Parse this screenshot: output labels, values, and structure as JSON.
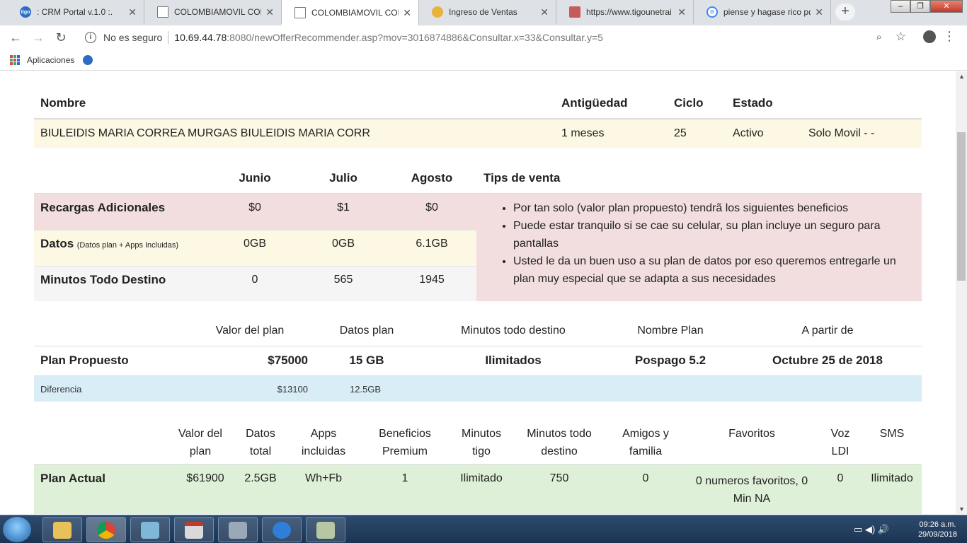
{
  "browser": {
    "tabs": [
      {
        "title": ": CRM Portal v.1.0 :."
      },
      {
        "title": "COLOMBIAMOVIL CONS"
      },
      {
        "title": "COLOMBIAMOVIL CONS"
      },
      {
        "title": "Ingreso de Ventas"
      },
      {
        "title": "https://www.tigounetrai"
      },
      {
        "title": "piense y hagase rico pdf"
      }
    ],
    "security": "No es seguro",
    "url_host": "10.69.44.78",
    "url_rest": ":8080/newOfferRecommender.asp?mov=3016874886&Consultar.x=33&Consultar.y=5",
    "bookmarks_label": "Aplicaciones"
  },
  "customer": {
    "headers": {
      "nombre": "Nombre",
      "antiguedad": "Antigüedad",
      "ciclo": "Ciclo",
      "estado": "Estado"
    },
    "nombre": "BIULEIDIS MARIA CORREA MURGAS BIULEIDIS MARIA CORR",
    "antiguedad": "1 meses",
    "ciclo": "25",
    "estado": "Activo",
    "tipo": "Solo Movil - -"
  },
  "consumo": {
    "months": [
      "Junio",
      "Julio",
      "Agosto"
    ],
    "tips_header": "Tips de venta",
    "rows": [
      {
        "label": "Recargas Adicionales",
        "sub": "",
        "values": [
          "$0",
          "$1",
          "$0"
        ]
      },
      {
        "label": "Datos",
        "sub": "(Datos plan + Apps Incluidas)",
        "values": [
          "0GB",
          "0GB",
          "6.1GB"
        ]
      },
      {
        "label": "Minutos Todo Destino",
        "sub": "",
        "values": [
          "0",
          "565",
          "1945"
        ]
      }
    ],
    "tips": [
      "Por tan solo (valor plan propuesto) tendrã los siguientes beneficios",
      "Puede estar tranquilo si se cae su celular, su plan incluye un seguro para pantallas",
      "Usted le da un buen uso a su plan de datos por eso queremos entregarle un plan muy especial que se adapta a sus necesidades"
    ]
  },
  "propuesto": {
    "headers": [
      "Valor del plan",
      "Datos plan",
      "Minutos todo destino",
      "Nombre Plan",
      "A partir de"
    ],
    "label": "Plan Propuesto",
    "valor": "$75000",
    "datos": "15 GB",
    "minutos": "Ilimitados",
    "nombre": "Pospago 5.2",
    "desde": "Octubre 25 de 2018",
    "diff_label": "Diferencia",
    "diff_valor": "$13100",
    "diff_datos": "12.5GB"
  },
  "actual": {
    "headers": [
      "Valor del plan",
      "Datos total",
      "Apps incluidas",
      "Beneficios Premium",
      "Minutos tigo",
      "Minutos todo destino",
      "Amigos y familia",
      "Favoritos",
      "Voz LDI",
      "SMS"
    ],
    "label": "Plan Actual",
    "values": [
      "$61900",
      "2.5GB",
      "Wh+Fb",
      "1",
      "Ilimitado",
      "750",
      "0",
      "0 numeros favoritos, 0 Min NA",
      "0",
      "Ilimitado"
    ]
  },
  "taskbar": {
    "time": "09:26 a.m.",
    "date": "29/09/2018"
  }
}
